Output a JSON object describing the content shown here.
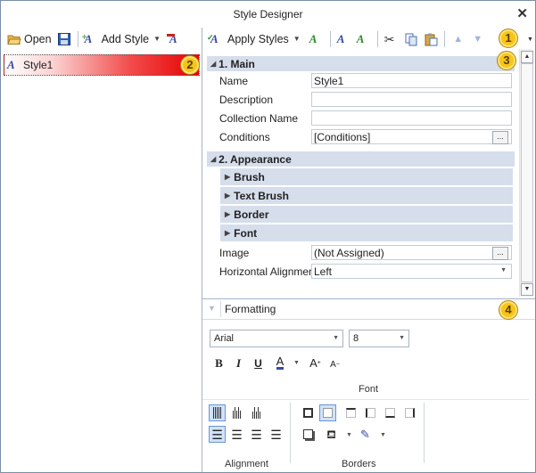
{
  "window": {
    "title": "Style Designer"
  },
  "toolbar": {
    "open_label": "Open",
    "add_style_label": "Add Style",
    "apply_styles_label": "Apply Styles"
  },
  "badges": [
    "1",
    "2",
    "3",
    "4"
  ],
  "style_list": {
    "items": [
      {
        "label": "Style1"
      }
    ]
  },
  "property_grid": {
    "main": {
      "header": "1. Main",
      "rows": [
        {
          "name": "Name",
          "value": "Style1"
        },
        {
          "name": "Description",
          "value": ""
        },
        {
          "name": "Collection Name",
          "value": ""
        },
        {
          "name": "Conditions",
          "value": "[Conditions]"
        }
      ]
    },
    "appearance": {
      "header": "2. Appearance",
      "groups": [
        "Brush",
        "Text Brush",
        "Border",
        "Font"
      ],
      "rows": [
        {
          "name": "Image",
          "value": "(Not Assigned)"
        },
        {
          "name": "Horizontal Alignment",
          "value": "Left"
        }
      ]
    }
  },
  "formatting": {
    "header": "Formatting",
    "font_name": "Arial",
    "font_size": "8",
    "font_group_label": "Font",
    "alignment_group_label": "Alignment",
    "borders_group_label": "Borders"
  },
  "colors": {
    "accent": "#3a49a6",
    "category_bg": "#d6deec",
    "badge": "#f5c518",
    "style_item_gradient_end": "#e60000"
  }
}
